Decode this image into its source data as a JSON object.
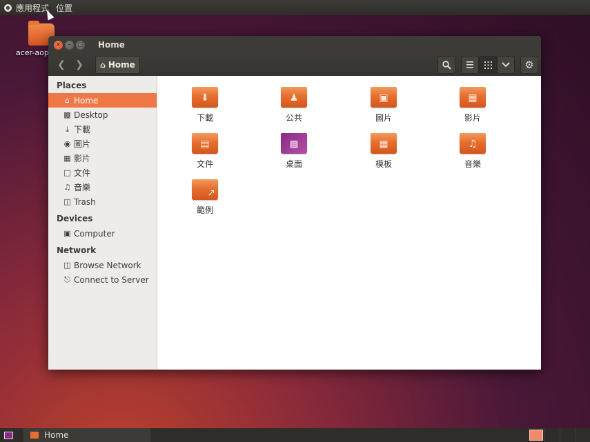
{
  "top_panel": {
    "applications_label": "應用程式",
    "places_label": "位置"
  },
  "desktop": {
    "icon_label": "acer-aop"
  },
  "window": {
    "title": "Home",
    "toolbar": {
      "path_label": "Home"
    },
    "sidebar": {
      "places_header": "Places",
      "places": [
        {
          "label": "Home",
          "icon": "home-icon"
        },
        {
          "label": "Desktop",
          "icon": "folder-icon"
        },
        {
          "label": "下載",
          "icon": "download-icon"
        },
        {
          "label": "圖片",
          "icon": "camera-icon"
        },
        {
          "label": "影片",
          "icon": "film-icon"
        },
        {
          "label": "文件",
          "icon": "document-icon"
        },
        {
          "label": "音樂",
          "icon": "music-icon"
        },
        {
          "label": "Trash",
          "icon": "trash-icon"
        }
      ],
      "devices_header": "Devices",
      "devices": [
        {
          "label": "Computer",
          "icon": "drive-icon"
        }
      ],
      "network_header": "Network",
      "network": [
        {
          "label": "Browse Network",
          "icon": "network-icon"
        },
        {
          "label": "Connect to Server",
          "icon": "server-icon"
        }
      ]
    },
    "files": [
      {
        "label": "下載",
        "icon": "download-folder-icon"
      },
      {
        "label": "公共",
        "icon": "public-folder-icon"
      },
      {
        "label": "圖片",
        "icon": "pictures-folder-icon"
      },
      {
        "label": "影片",
        "icon": "videos-folder-icon"
      },
      {
        "label": "文件",
        "icon": "documents-folder-icon"
      },
      {
        "label": "桌面",
        "icon": "desktop-folder-icon"
      },
      {
        "label": "模板",
        "icon": "templates-folder-icon"
      },
      {
        "label": "音樂",
        "icon": "music-folder-icon"
      },
      {
        "label": "範例",
        "icon": "examples-link-icon"
      }
    ]
  },
  "bottom_panel": {
    "task_label": "Home"
  },
  "colors": {
    "accent": "#f07746",
    "panel": "#3c3b37",
    "folder": "#e56f2e"
  }
}
